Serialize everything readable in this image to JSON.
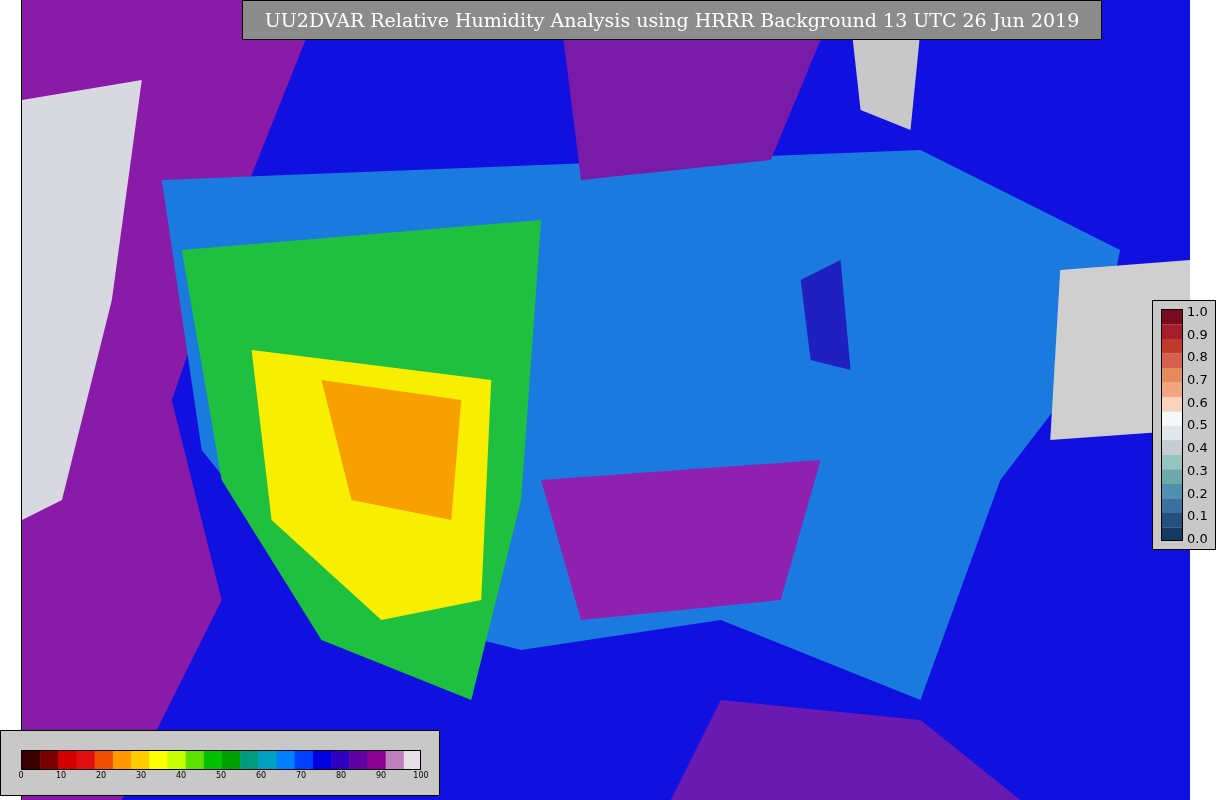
{
  "title": "UU2DVAR Relative Humidity Analysis using HRRR Background 13 UTC 26 Jun 2019",
  "scale_legend": {
    "labels": [
      "1.0",
      "0.9",
      "0.8",
      "0.7",
      "0.6",
      "0.5",
      "0.4",
      "0.3",
      "0.2",
      "0.1",
      "0.0"
    ]
  },
  "humidity_legend": {
    "labels": [
      "0",
      "10",
      "20",
      "30",
      "40",
      "50",
      "60",
      "70",
      "80",
      "90",
      "100"
    ]
  }
}
